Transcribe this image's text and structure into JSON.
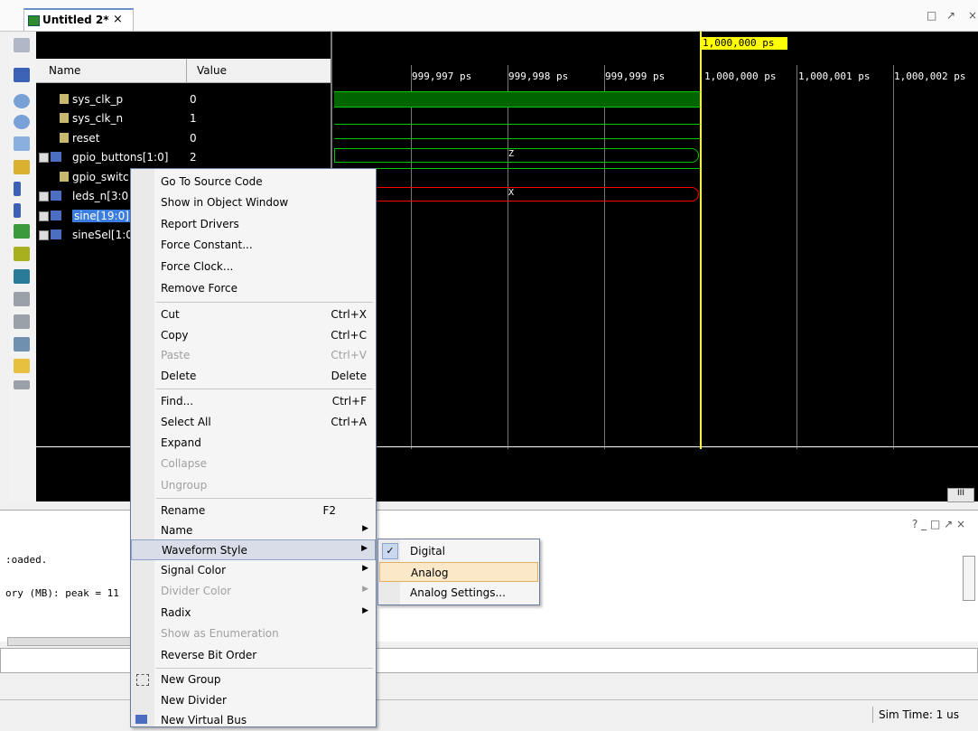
{
  "tab": {
    "title": "Untitled 2*",
    "close": "×"
  },
  "window_controls": [
    "□",
    "↗",
    "×"
  ],
  "columns": {
    "name": "Name",
    "value": "Value"
  },
  "signals": [
    {
      "name": "sys_clk_p",
      "value": "0",
      "kind": "wire",
      "expandable": false
    },
    {
      "name": "sys_clk_n",
      "value": "1",
      "kind": "wire",
      "expandable": false
    },
    {
      "name": "reset",
      "value": "0",
      "kind": "wire",
      "expandable": false
    },
    {
      "name": "gpio_buttons[1:0]",
      "value": "2",
      "kind": "bus",
      "expandable": true
    },
    {
      "name": "gpio_switc",
      "value": "",
      "kind": "wire",
      "expandable": false
    },
    {
      "name": "leds_n[3:0",
      "value": "",
      "kind": "bus",
      "expandable": true
    },
    {
      "name": "sine[19:0]",
      "value": "",
      "kind": "bus",
      "expandable": true,
      "selected": true
    },
    {
      "name": "sineSel[1:0",
      "value": "",
      "kind": "bus",
      "expandable": true
    }
  ],
  "wave": {
    "ticks": [
      "999,997 ps",
      "999,998 ps",
      "999,999 ps",
      "1,000,000 ps",
      "1,000,001 ps",
      "1,000,002 ps"
    ],
    "cursor_label": "1,000,000 ps",
    "bus_values": {
      "gpio_buttons": "Z",
      "leds_n": "X"
    },
    "colors": {
      "signal": "#00c800",
      "clock_fill": "#006400",
      "error": "#ff0000",
      "cursor": "#ffff00",
      "grid": "#777777"
    }
  },
  "context_menu": {
    "items": [
      {
        "label": "Go To Source Code"
      },
      {
        "label": "Show in Object Window"
      },
      {
        "label": "Report Drivers"
      },
      {
        "label": "Force Constant..."
      },
      {
        "label": "Force Clock..."
      },
      {
        "label": "Remove Force"
      },
      {
        "label": "Cut",
        "shortcut": "Ctrl+X"
      },
      {
        "label": "Copy",
        "shortcut": "Ctrl+C"
      },
      {
        "label": "Paste",
        "shortcut": "Ctrl+V",
        "disabled": true
      },
      {
        "label": "Delete",
        "shortcut": "Delete"
      },
      {
        "label": "Find...",
        "shortcut": "Ctrl+F"
      },
      {
        "label": "Select All",
        "shortcut": "Ctrl+A"
      },
      {
        "label": "Expand"
      },
      {
        "label": "Collapse",
        "disabled": true
      },
      {
        "label": "Ungroup",
        "disabled": true
      },
      {
        "label": "Rename",
        "shortcut": "F2"
      },
      {
        "label": "Name",
        "submenu": true
      },
      {
        "label": "Waveform Style",
        "submenu": true,
        "highlighted": true
      },
      {
        "label": "Signal Color",
        "submenu": true
      },
      {
        "label": "Divider Color",
        "submenu": true,
        "disabled": true
      },
      {
        "label": "Radix",
        "submenu": true
      },
      {
        "label": "Show as Enumeration",
        "disabled": true
      },
      {
        "label": "Reverse Bit Order"
      },
      {
        "label": "New Group",
        "icon": "group-icon"
      },
      {
        "label": "New Divider"
      },
      {
        "label": "New Virtual Bus",
        "icon": "bus-icon"
      }
    ],
    "submenu_arrow": "▶"
  },
  "waveform_style_submenu": {
    "items": [
      {
        "label": "Digital",
        "checked": true
      },
      {
        "label": "Analog",
        "highlighted": true
      },
      {
        "label": "Analog Settings..."
      }
    ],
    "check_glyph": "✓"
  },
  "console": {
    "lines": [
      ":oaded.",
      "ory (MB): peak = 11"
    ],
    "controls": "? _ □ ↗ ×"
  },
  "status": {
    "sim_time": "Sim Time: 1 us"
  },
  "scroll_label": "III"
}
